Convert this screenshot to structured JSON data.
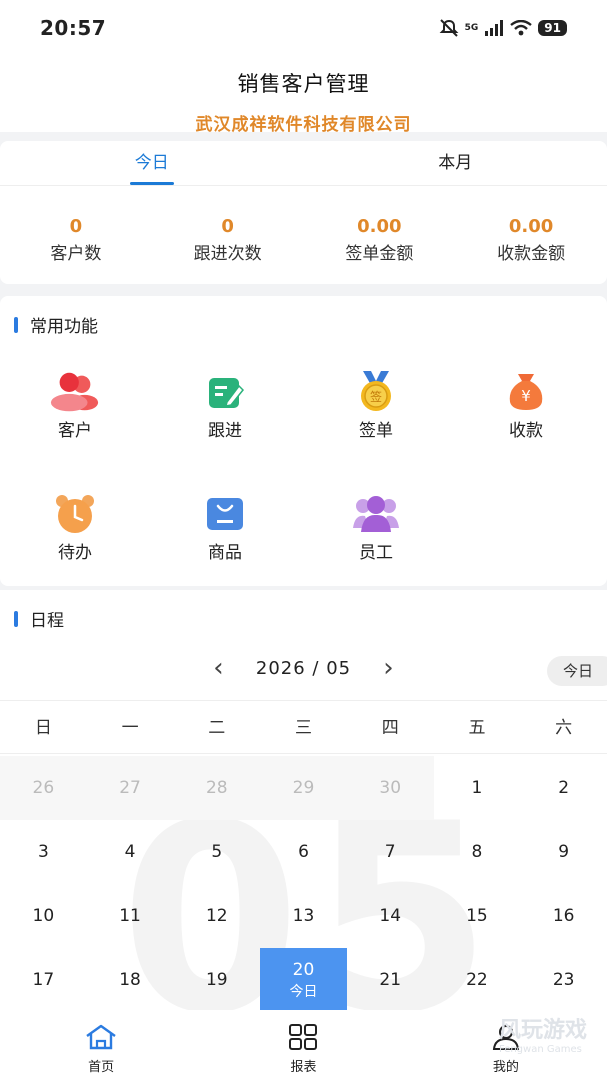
{
  "status": {
    "time": "20:57",
    "network": "5G",
    "battery": "91"
  },
  "header": {
    "title": "销售客户管理",
    "company": "武汉成祥软件科技有限公司"
  },
  "stats": {
    "tabs": [
      {
        "label": "今日"
      },
      {
        "label": "本月"
      }
    ],
    "items": [
      {
        "value": "0",
        "label": "客户数"
      },
      {
        "value": "0",
        "label": "跟进次数"
      },
      {
        "value": "0.00",
        "label": "签单金额"
      },
      {
        "value": "0.00",
        "label": "收款金额"
      }
    ]
  },
  "functions": {
    "title": "常用功能",
    "items": [
      {
        "label": "客户",
        "icon": "customers-icon"
      },
      {
        "label": "跟进",
        "icon": "follow-up-icon"
      },
      {
        "label": "签单",
        "icon": "sign-medal-icon",
        "glyph": "签"
      },
      {
        "label": "收款",
        "icon": "money-bag-icon",
        "glyph": "¥"
      },
      {
        "label": "待办",
        "icon": "alarm-clock-icon"
      },
      {
        "label": "商品",
        "icon": "product-bag-icon"
      },
      {
        "label": "员工",
        "icon": "staff-icon"
      }
    ]
  },
  "schedule": {
    "title": "日程",
    "year_month": "2026 / 05",
    "today_button": "今日",
    "big_month": "05",
    "weekdays": [
      "日",
      "一",
      "二",
      "三",
      "四",
      "五",
      "六"
    ],
    "days": [
      "26",
      "27",
      "28",
      "29",
      "30",
      "1",
      "2",
      "3",
      "4",
      "5",
      "6",
      "7",
      "8",
      "9",
      "10",
      "11",
      "12",
      "13",
      "14",
      "15",
      "16",
      "17",
      "18",
      "19",
      "20",
      "21",
      "22",
      "23"
    ],
    "selected_day": "20",
    "selected_sub": "今日"
  },
  "bottom_nav": [
    {
      "label": "首页"
    },
    {
      "label": "报表"
    },
    {
      "label": "我的"
    }
  ],
  "watermark": {
    "main": "风玩游戏",
    "sub": "Fengwan Games"
  },
  "colors": {
    "accent": "#1b7ad6",
    "orange": "#e0882a",
    "selected": "#4c94f0"
  }
}
